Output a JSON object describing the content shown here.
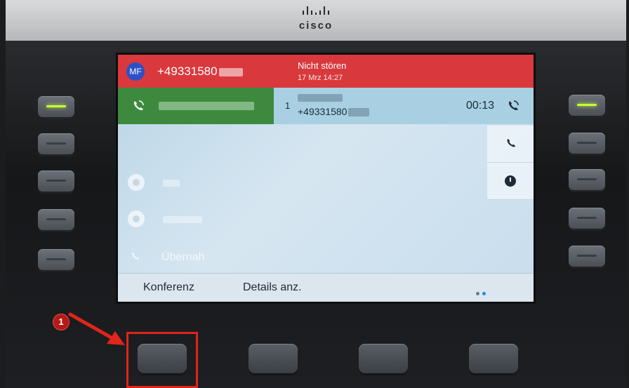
{
  "brand": {
    "logo": "cisco"
  },
  "header": {
    "avatar_initials": "MF",
    "caller_number": "+49331580",
    "status_title": "Nicht stören",
    "status_time": "17 Mrz 14:27"
  },
  "active_call": {
    "line_index": "1",
    "number": "+49331580",
    "timer": "00:13"
  },
  "lines": [
    {
      "label": "Übernah"
    }
  ],
  "softkeys": {
    "key1": "Konferenz",
    "key2": "Details anz."
  },
  "annotation": {
    "step": "1"
  },
  "colors": {
    "header_red": "#d9393d",
    "line_green": "#3d8a3f",
    "call_blue": "#a8d0e2",
    "led_green": "#c8ff3a",
    "annotation_red": "#e0251b"
  },
  "icons": [
    "phone-icon",
    "clock-icon",
    "call-active-icon",
    "ring-icon",
    "arrow-icon"
  ],
  "pagination": {
    "dots": 2,
    "active": 2
  }
}
